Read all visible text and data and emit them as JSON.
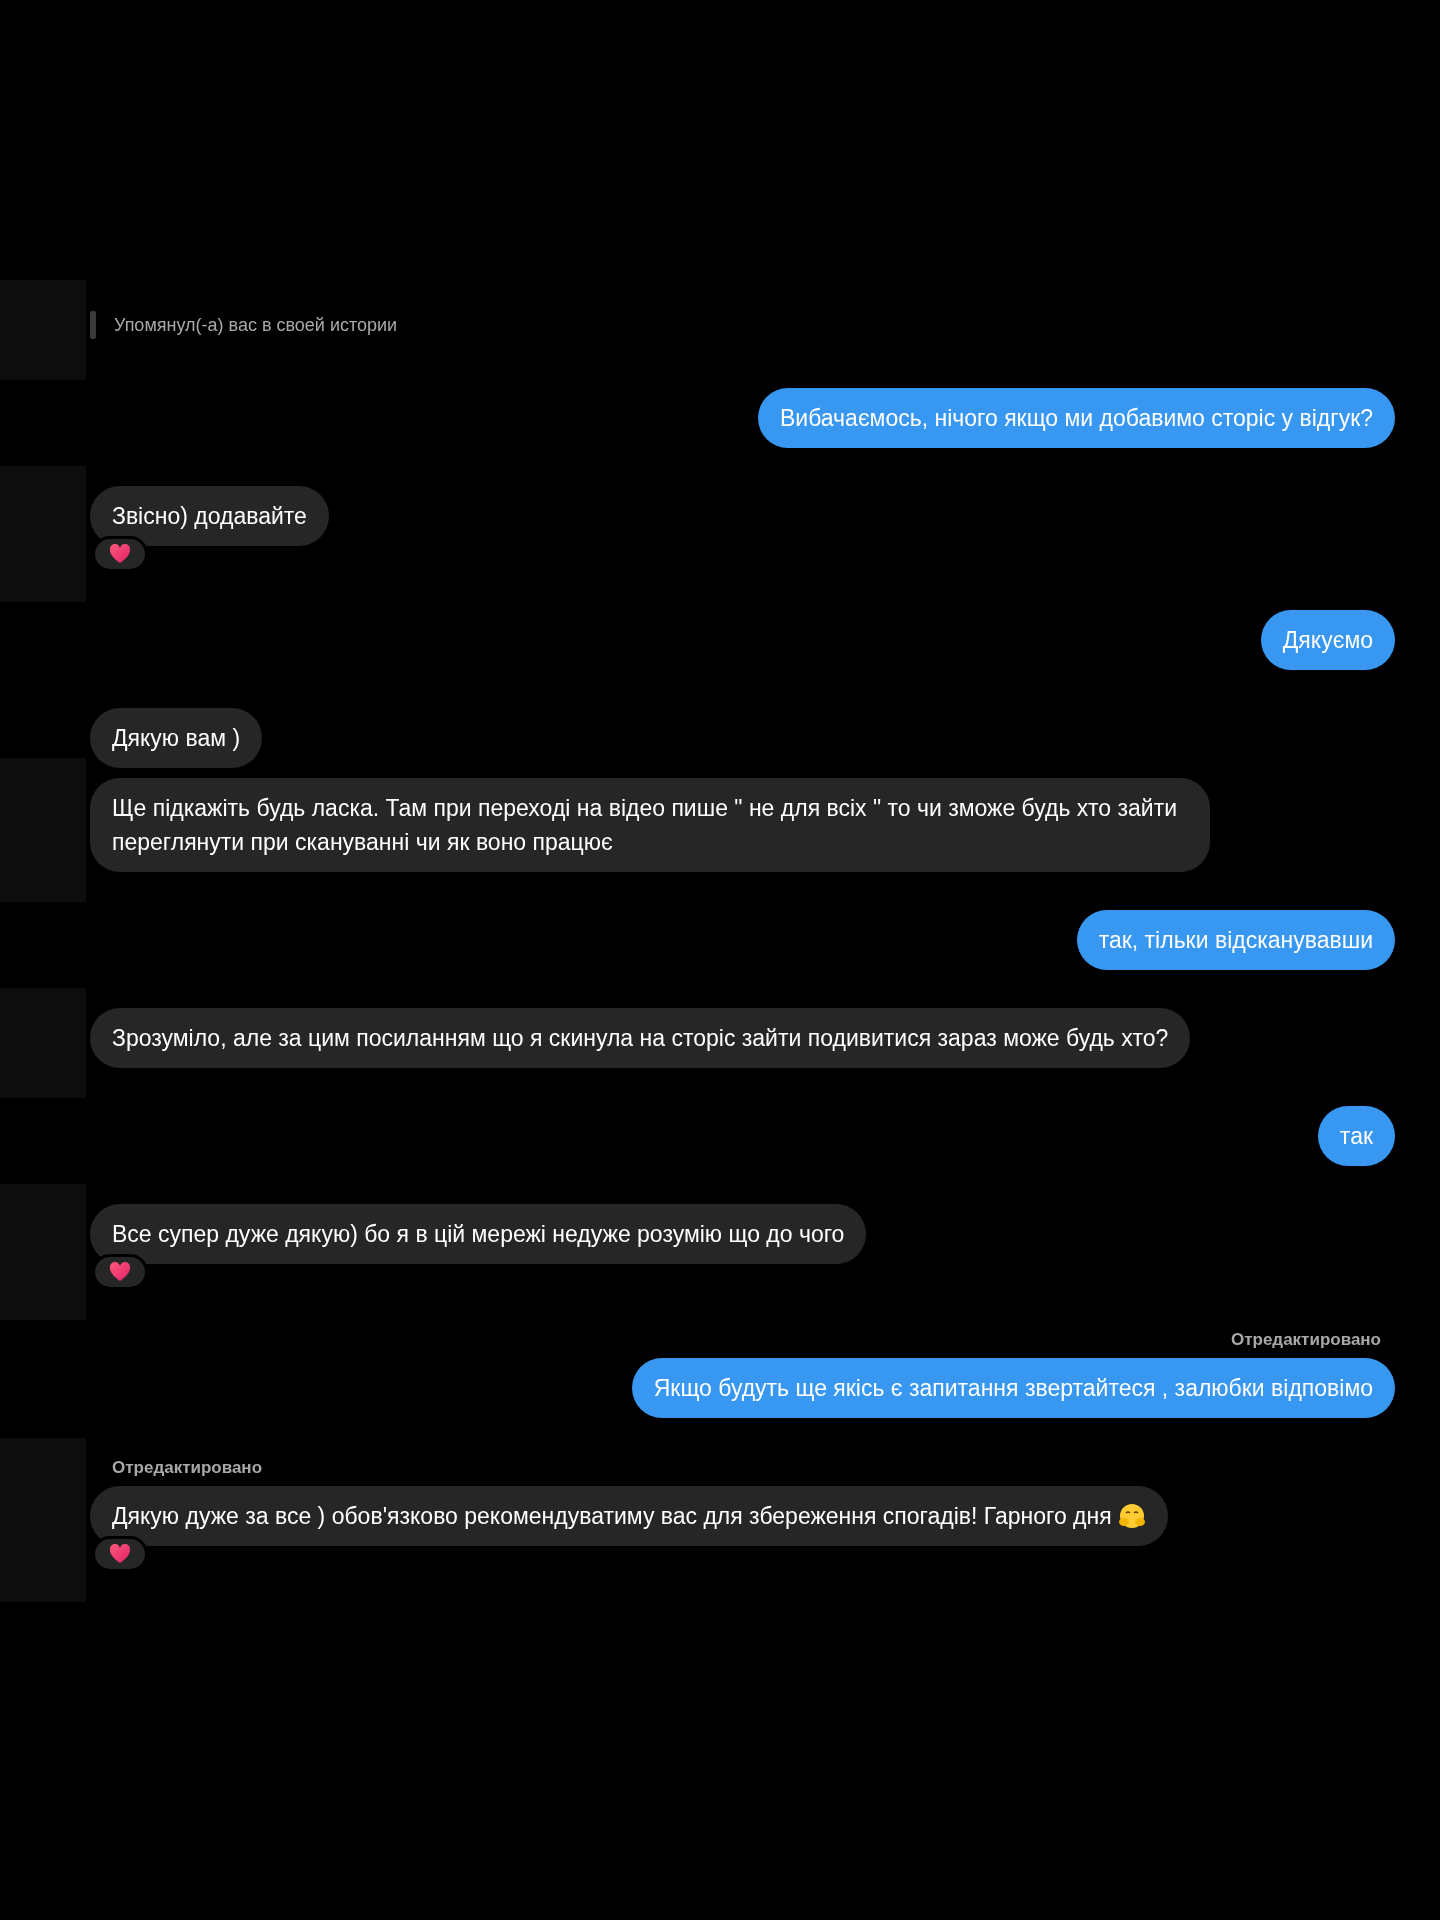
{
  "messages": [
    {
      "kind": "mention",
      "text": "Упомянул(-а) вас в своей истории"
    },
    {
      "kind": "outgoing",
      "text": "Вибачаємось, нічого якщо ми добавимо сторіс у відгук?"
    },
    {
      "kind": "incoming",
      "text": "Звісно) додавайте",
      "reacted": true
    },
    {
      "kind": "outgoing",
      "text": "Дякуємо"
    },
    {
      "kind": "incoming",
      "text": "Дякую вам )"
    },
    {
      "kind": "incoming",
      "text": "Ще підкажіть будь ласка. Там при переході на відео пише \" не для всіх \"  то чи зможе будь хто зайти переглянути при скануванні чи як воно працює"
    },
    {
      "kind": "outgoing",
      "text": "так, тільки відсканувавши"
    },
    {
      "kind": "incoming",
      "text": "Зрозуміло, але за цим посиланням що я скинула на сторіс зайти  подивитися зараз може будь хто?"
    },
    {
      "kind": "outgoing",
      "text": "так"
    },
    {
      "kind": "incoming",
      "text": "Все супер дуже дякую) бо я в цій мережі недуже розумію що до чого",
      "reacted": true
    },
    {
      "kind": "outgoing",
      "text": "Якщо будуть ще якісь є запитання звертайтеся , залюбки відповімо",
      "edited_label": "Отредактировано"
    },
    {
      "kind": "incoming",
      "text": "Дякую дуже за все )  обов'язково рекомендуватиму вас для збереження спогадів! Гарного дня",
      "trailing_emoji": true,
      "reacted": true,
      "edited_label": "Отредактировано"
    }
  ]
}
